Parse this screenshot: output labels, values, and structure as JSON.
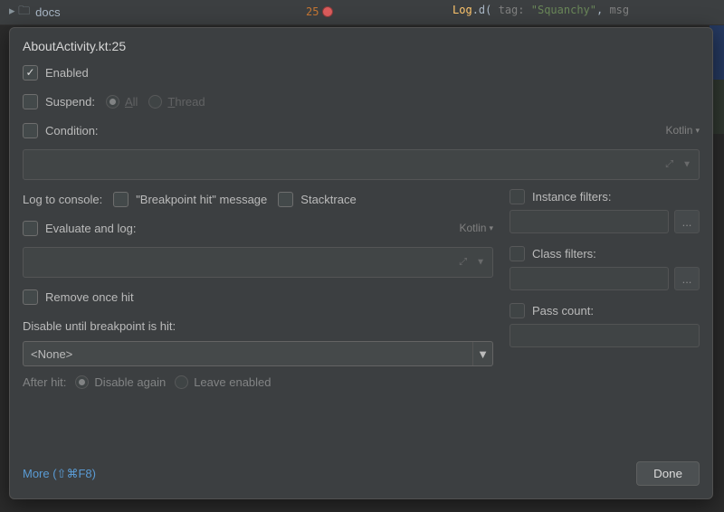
{
  "background": {
    "folder_label": "docs",
    "line_number": "25",
    "code": {
      "fn": "Log",
      "method": "d",
      "param1": "tag:",
      "string": "\"Squanchy\"",
      "param2": "msg"
    }
  },
  "popup": {
    "title": "AboutActivity.kt:25",
    "enabled": {
      "label": "Enabled",
      "checked": true
    },
    "suspend": {
      "label": "Suspend:",
      "all": "All",
      "thread": "Thread",
      "checked": false
    },
    "condition": {
      "label": "Condition:",
      "lang": "Kotlin"
    },
    "log_to_console": {
      "label": "Log to console:",
      "bp_hit": "\"Breakpoint hit\" message",
      "stacktrace": "Stacktrace"
    },
    "evaluate": {
      "label": "Evaluate and log:",
      "lang": "Kotlin"
    },
    "remove_once_hit": {
      "label": "Remove once hit"
    },
    "disable_until": {
      "label": "Disable until breakpoint is hit:",
      "value": "<None>"
    },
    "after_hit": {
      "label": "After hit:",
      "disable_again": "Disable again",
      "leave_enabled": "Leave enabled"
    },
    "instance_filters": {
      "label": "Instance filters:"
    },
    "class_filters": {
      "label": "Class filters:"
    },
    "pass_count": {
      "label": "Pass count:"
    },
    "browse": "...",
    "more_link": "More (⇧⌘F8)",
    "done": "Done"
  }
}
